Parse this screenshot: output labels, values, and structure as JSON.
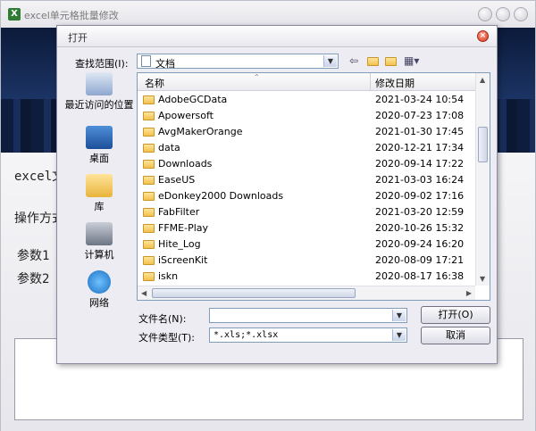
{
  "app": {
    "title": "excel单元格批量修改",
    "labels": {
      "excel_file": "excel文",
      "mode": "操作方式",
      "param1": "参数1",
      "param2": "参数2"
    }
  },
  "dialog": {
    "title": "打开",
    "look_in_label": "查找范围(I):",
    "look_in_value": "文档",
    "places": [
      {
        "label": "最近访问的位置",
        "icon": "recent-icon"
      },
      {
        "label": "桌面",
        "icon": "desktop-icon"
      },
      {
        "label": "库",
        "icon": "library-icon"
      },
      {
        "label": "计算机",
        "icon": "computer-icon"
      },
      {
        "label": "网络",
        "icon": "network-icon"
      }
    ],
    "columns": {
      "name": "名称",
      "modified": "修改日期"
    },
    "files": [
      {
        "name": "AdobeGCData",
        "modified": "2021-03-24 10:54"
      },
      {
        "name": "Apowersoft",
        "modified": "2020-07-23 17:08"
      },
      {
        "name": "AvgMakerOrange",
        "modified": "2021-01-30 17:45"
      },
      {
        "name": "data",
        "modified": "2020-12-21 17:34"
      },
      {
        "name": "Downloads",
        "modified": "2020-09-14 17:22"
      },
      {
        "name": "EaseUS",
        "modified": "2021-03-03 16:24"
      },
      {
        "name": "eDonkey2000 Downloads",
        "modified": "2020-09-02 17:16"
      },
      {
        "name": "FabFilter",
        "modified": "2021-03-20 12:59"
      },
      {
        "name": "FFME-Play",
        "modified": "2020-10-26 15:32"
      },
      {
        "name": "Hite_Log",
        "modified": "2020-09-24 16:20"
      },
      {
        "name": "iScreenKit",
        "modified": "2020-08-09 17:21"
      },
      {
        "name": "iskn",
        "modified": "2020-08-17 16:38"
      }
    ],
    "filename_label": "文件名(N):",
    "filename_value": "",
    "filetype_label": "文件类型(T):",
    "filetype_value": "*.xls;*.xlsx",
    "open_button": "打开(O)",
    "cancel_button": "取消"
  }
}
